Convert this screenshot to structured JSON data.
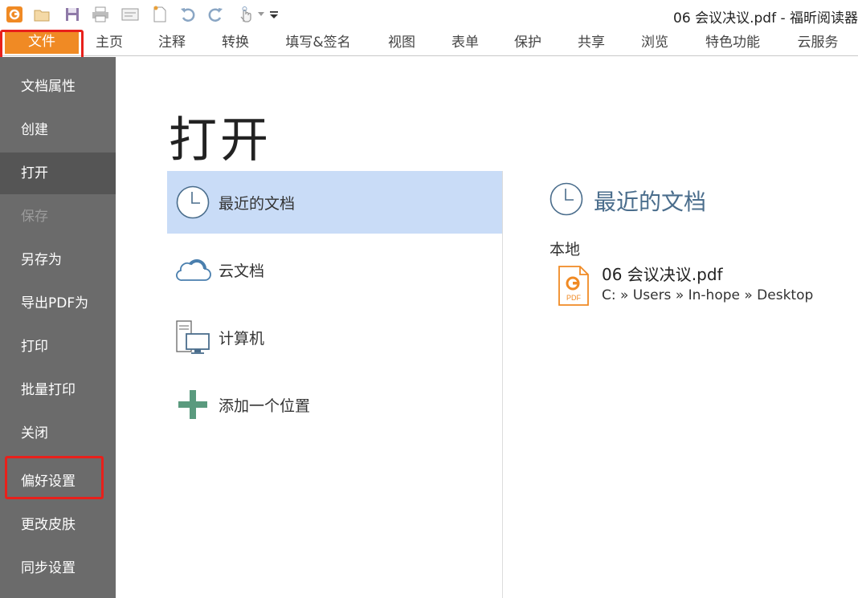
{
  "window": {
    "title": "06 会议决议.pdf - 福昕阅读器"
  },
  "quick_access": {
    "icons": [
      "app-logo-icon",
      "open-folder-icon",
      "save-icon",
      "print-icon",
      "scan-icon",
      "new-doc-icon",
      "undo-icon",
      "redo-icon",
      "hand-tool-icon",
      "customize-dropdown-icon"
    ]
  },
  "ribbon": {
    "tabs": [
      "文件",
      "主页",
      "注释",
      "转换",
      "填写&签名",
      "视图",
      "表单",
      "保护",
      "共享",
      "浏览",
      "特色功能",
      "云服务"
    ],
    "active_tab": "文件",
    "accent_color": "#f08a24"
  },
  "nav": {
    "items": [
      "文档属性",
      "创建",
      "打开",
      "保存",
      "另存为",
      "导出PDF为",
      "打印",
      "批量打印",
      "关闭",
      "偏好设置",
      "更改皮肤",
      "同步设置"
    ],
    "active": "打开",
    "disabled": "保存",
    "highlighted": "偏好设置"
  },
  "main": {
    "title": "打开",
    "places": [
      {
        "label": "最近的文档",
        "icon": "clock-icon"
      },
      {
        "label": "云文档",
        "icon": "cloud-icon"
      },
      {
        "label": "计算机",
        "icon": "computer-icon"
      },
      {
        "label": "添加一个位置",
        "icon": "plus-icon"
      }
    ],
    "recent": {
      "heading": "最近的文档",
      "section": "本地",
      "files": [
        {
          "name": "06 会议决议.pdf",
          "path": "C: » Users » In-hope » Desktop",
          "icon": "pdf-file-icon"
        }
      ]
    }
  },
  "colors": {
    "nav_bg": "#6b6b6b",
    "nav_active": "#555555",
    "selected_place": "#c9dcf7",
    "highlight_box": "#e8201b",
    "heading_blue": "#4a6d8c"
  }
}
